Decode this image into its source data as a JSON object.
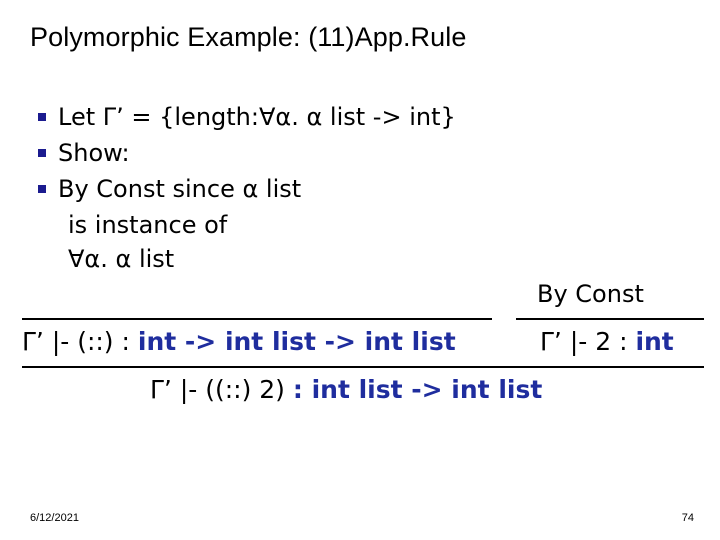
{
  "slide": {
    "title": "Polymorphic Example: (11)App.Rule",
    "bullets": [
      "Let Γ’ = {length:∀α. α list -> int}",
      "Show:",
      "By Const since α list"
    ],
    "sub_lines": [
      "is instance of",
      "∀α. α list"
    ],
    "derivation": {
      "premise_right_label": "By Const",
      "conclusion_left_plain": "Γ’ |- (::) : ",
      "conclusion_left_blue": "int -> int list -> int list",
      "conclusion_right_plain": "Γ’ |- 2 : ",
      "conclusion_right_blue": "int",
      "final_plain": "Γ’ |- ((::) 2) ",
      "final_blue": ": int list -> int list"
    },
    "footer": {
      "date": "6/12/2021",
      "page": "74"
    },
    "colors": {
      "bullet_marker": "#1b1b8f",
      "accent_blue": "#1f2d9e",
      "text": "#000000",
      "background": "#ffffff"
    }
  }
}
